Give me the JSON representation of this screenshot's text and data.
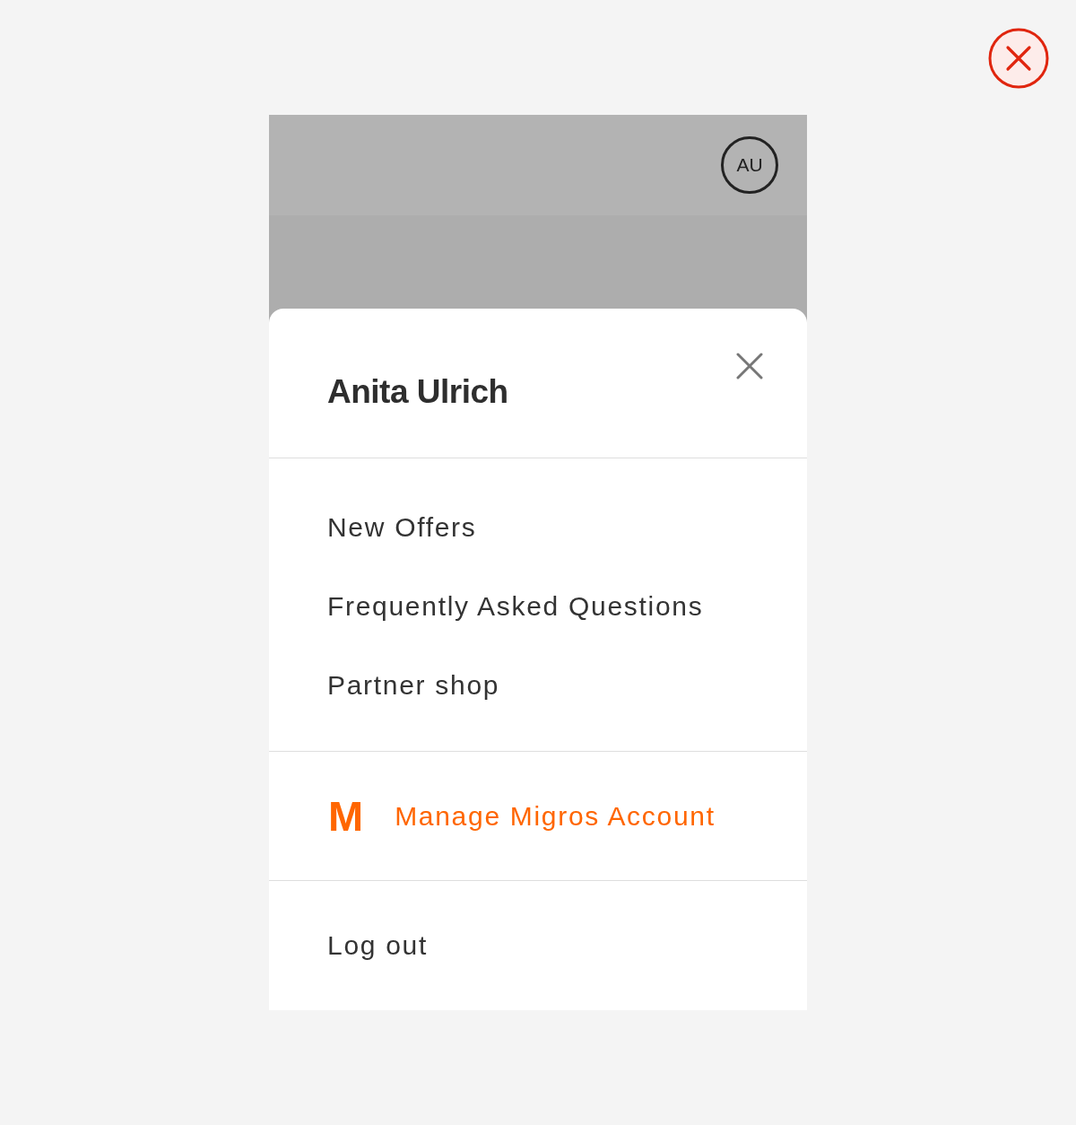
{
  "header": {
    "avatar_initials": "AU"
  },
  "sheet": {
    "title": "Anita Ulrich",
    "menu_items": [
      "New Offers",
      "Frequently Asked Questions",
      "Partner shop"
    ],
    "account_link": {
      "logo": "M",
      "label": "Manage Migros Account"
    },
    "logout": {
      "label": "Log out"
    }
  }
}
